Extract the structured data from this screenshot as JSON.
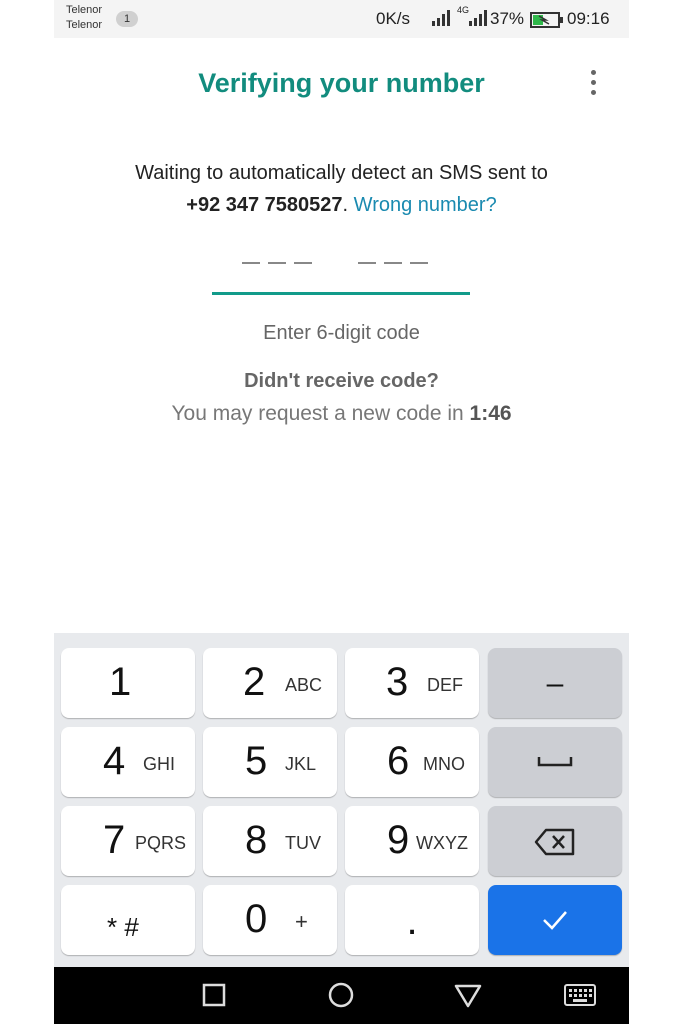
{
  "status_bar": {
    "carrier_1": "Telenor",
    "carrier_2": "Telenor",
    "sim_badge": "1",
    "network_speed": "0K/s",
    "network_type": "4G",
    "battery": "37%",
    "time": "09:16"
  },
  "header": {
    "title": "Verifying your number",
    "menu_icon": "more-vert-icon"
  },
  "main": {
    "description": "Waiting to automatically detect an SMS sent to",
    "phone_number": "+92 347 7580527",
    "period": ".",
    "wrong_number_link": "Wrong number?",
    "code_hint": "Enter 6-digit code",
    "didnt_receive": "Didn't receive code?",
    "resend_text": "You may request a new code in",
    "timer": "1:46"
  },
  "keyboard": {
    "keys": [
      {
        "digit": "1",
        "letters": ""
      },
      {
        "digit": "2",
        "letters": "ABC"
      },
      {
        "digit": "3",
        "letters": "DEF"
      },
      {
        "digit": "–",
        "letters": ""
      },
      {
        "digit": "4",
        "letters": "GHI"
      },
      {
        "digit": "5",
        "letters": "JKL"
      },
      {
        "digit": "6",
        "letters": "MNO"
      },
      {
        "digit": "space-icon",
        "letters": ""
      },
      {
        "digit": "7",
        "letters": "PQRS"
      },
      {
        "digit": "8",
        "letters": "TUV"
      },
      {
        "digit": "9",
        "letters": "WXYZ"
      },
      {
        "digit": "backspace-icon",
        "letters": ""
      },
      {
        "digit": "* #",
        "letters": ""
      },
      {
        "digit": "0",
        "letters": "+"
      },
      {
        "digit": ".",
        "letters": ""
      },
      {
        "digit": "check-icon",
        "letters": ""
      }
    ]
  },
  "navigation_bar": {
    "recents_icon": "square-icon",
    "home_icon": "circle-icon",
    "back_icon": "triangle-icon",
    "keyboard_icon": "keyboard-icon"
  },
  "colors": {
    "accent": "#128c7e",
    "link": "#1a8ab0",
    "done_key": "#1a73e8"
  }
}
